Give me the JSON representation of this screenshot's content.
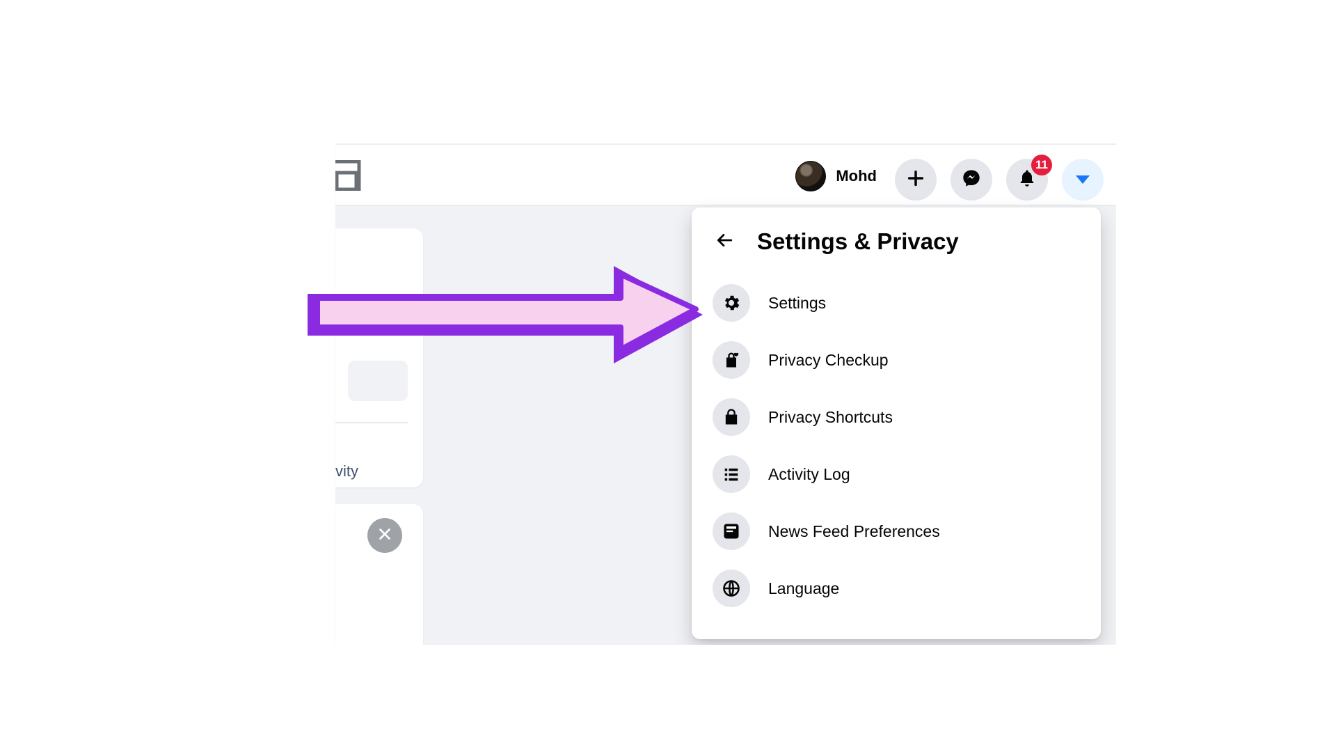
{
  "header": {
    "profile_name": "Mohd",
    "notification_count": "11"
  },
  "page": {
    "side_text_fragment": "vity"
  },
  "dropdown": {
    "title": "Settings & Privacy",
    "items": [
      {
        "label": "Settings"
      },
      {
        "label": "Privacy Checkup"
      },
      {
        "label": "Privacy Shortcuts"
      },
      {
        "label": "Activity Log"
      },
      {
        "label": "News Feed Preferences"
      },
      {
        "label": "Language"
      }
    ]
  },
  "colors": {
    "accent": "#1877f2",
    "badge": "#e41e3f",
    "arrow_outline": "#8a2be2",
    "arrow_fill": "#f8d1ef"
  }
}
